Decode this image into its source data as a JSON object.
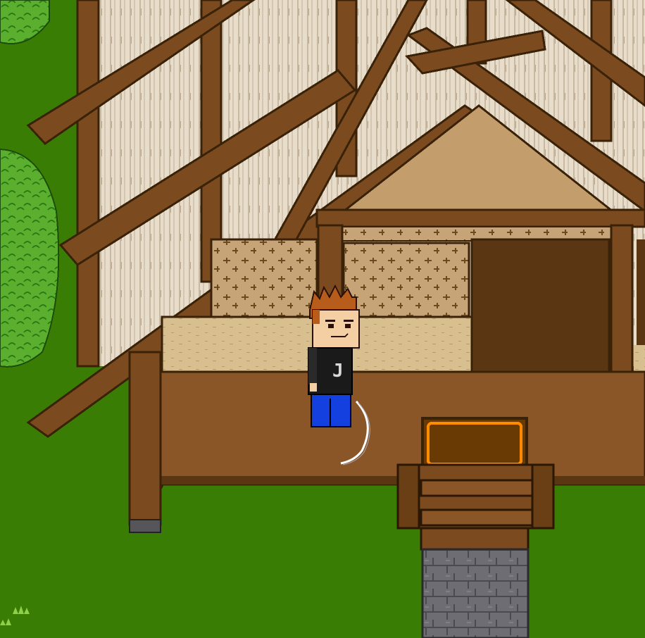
{
  "scene": {
    "type": "top-down-pixel-rpg",
    "colors": {
      "grass": "#3a7d05",
      "grass_tuft": "#8fcf4a",
      "tree_leaf": "#5ab02e",
      "tree_leaf_dark": "#2f7a17",
      "wall_panel": "#e8dccb",
      "wall_stripe": "#c8b9a3",
      "timber": "#7b4a1e",
      "timber_dark": "#3a2209",
      "roof_tan": "#c49d6d",
      "lattice": "#c6a477",
      "lattice_mark": "#6b4a22",
      "tatami": "#d8bf8f",
      "doorway": "#5a3612",
      "deck": "#8a5527",
      "sign_fill": "#6a3a05",
      "sign_border": "#ff8c00",
      "stone": "#6d6d73",
      "stone_dark": "#4a4a50",
      "shirt": "#1a1a1a",
      "pants": "#1440e0",
      "hair": "#b85c1c",
      "skin": "#f4cfa3"
    },
    "character": {
      "shirt_letter": "J",
      "facing": "front"
    },
    "icons": [
      "tree-icon",
      "grass-tuft-icon",
      "sign-icon",
      "player-icon",
      "swing-effect-icon"
    ]
  }
}
